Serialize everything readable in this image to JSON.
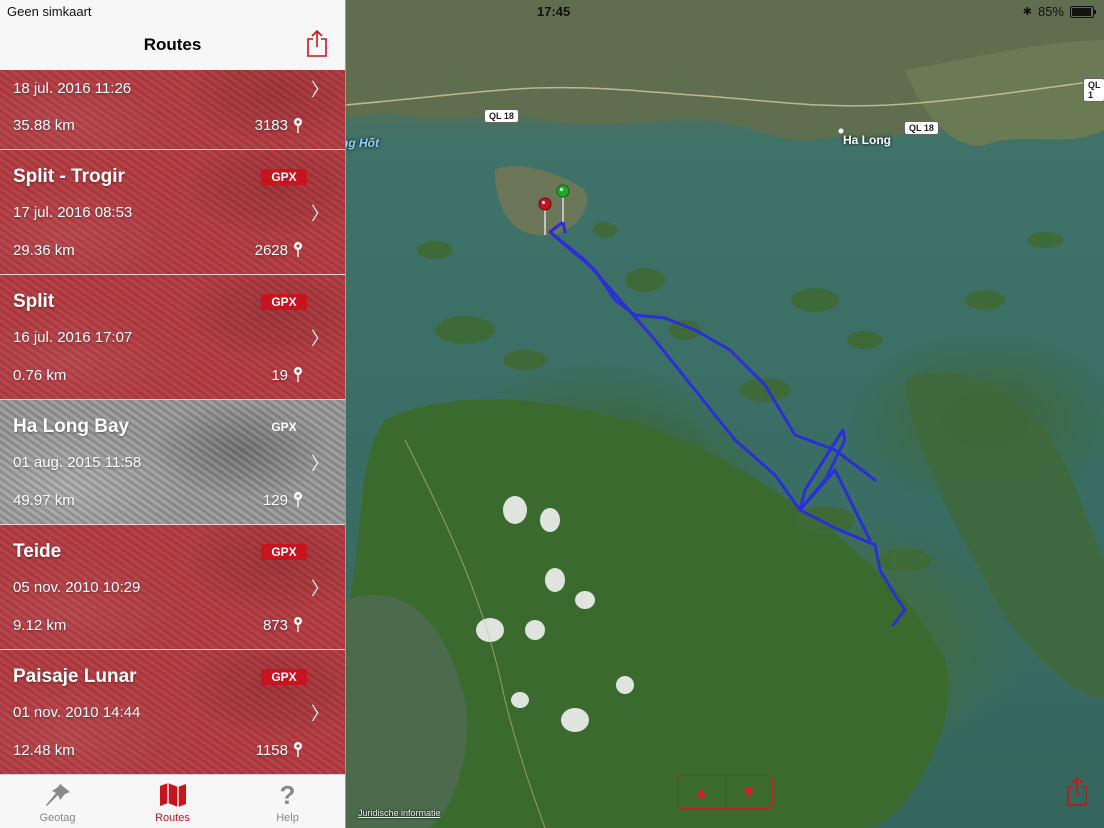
{
  "status": {
    "carrier": "Geen simkaart",
    "time": "17:45",
    "battery": "85%",
    "battery_level": 0.85
  },
  "nav": {
    "title": "Routes",
    "share_icon": "share-icon"
  },
  "routes": [
    {
      "name": "",
      "gpx": "",
      "date": "18 jul. 2016 11:26",
      "distance": "35.88 km",
      "points": "3183"
    },
    {
      "name": "Split - Trogir",
      "gpx": "GPX",
      "date": "17 jul. 2016 08:53",
      "distance": "29.36 km",
      "points": "2628"
    },
    {
      "name": "Split",
      "gpx": "GPX",
      "date": "16 jul. 2016 17:07",
      "distance": "0.76 km",
      "points": "19"
    },
    {
      "name": "Ha Long Bay",
      "gpx": "GPX",
      "date": "01 aug. 2015 11:58",
      "distance": "49.97 km",
      "points": "129"
    },
    {
      "name": "Teide",
      "gpx": "GPX",
      "date": "05 nov. 2010 10:29",
      "distance": "9.12 km",
      "points": "873"
    },
    {
      "name": "Paisaje Lunar",
      "gpx": "GPX",
      "date": "01 nov. 2010 14:44",
      "distance": "12.48 km",
      "points": "1158"
    }
  ],
  "tabs": [
    {
      "label": "Geotag",
      "icon": "pushpin-icon"
    },
    {
      "label": "Routes",
      "icon": "map-icon"
    },
    {
      "label": "Help",
      "icon": "question-icon"
    }
  ],
  "map": {
    "labels": {
      "ha_long": "Ha Long",
      "water": "ng Hốt",
      "road1": "QL 18",
      "road2": "QL 18",
      "road3": "QL 1"
    },
    "legal": "Juridische informatie",
    "up_arrow": "▲",
    "down_arrow": "▼",
    "track_color": "#2a2fd6"
  },
  "colors": {
    "accent": "#c8141e",
    "row_bg": "#b13a40",
    "selected_bg": "#9a9a9a"
  }
}
